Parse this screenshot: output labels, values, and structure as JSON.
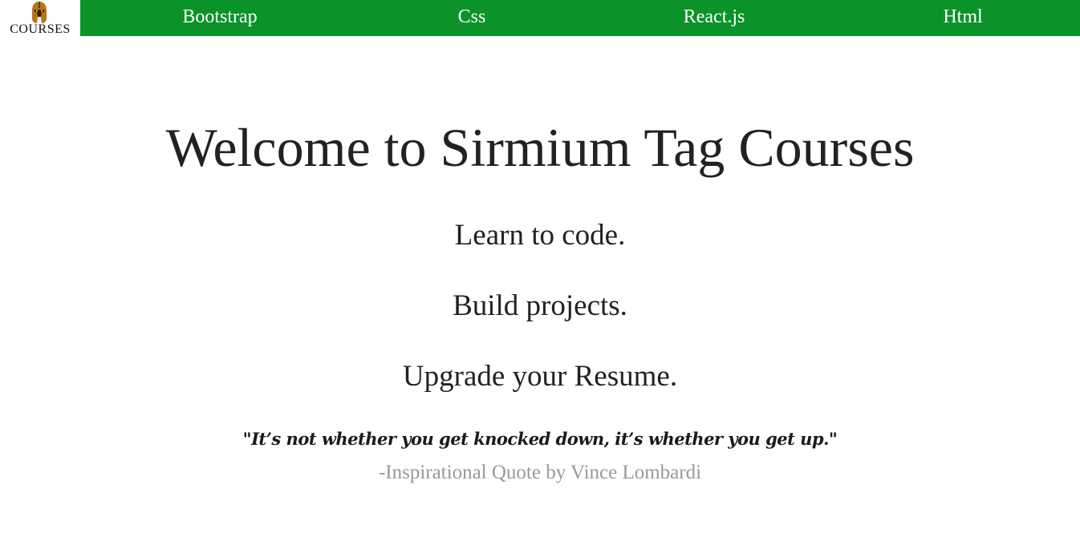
{
  "logo": {
    "text": "COURSES",
    "icon": "spartan-helmet-icon"
  },
  "nav": {
    "links": [
      {
        "label": "Bootstrap"
      },
      {
        "label": "Css"
      },
      {
        "label": "React.js"
      },
      {
        "label": "Html"
      }
    ],
    "background_color": "#0b932a",
    "text_color": "#ffffff"
  },
  "hero": {
    "title": "Welcome to Sirmium Tag Courses",
    "taglines": [
      "Learn to code.",
      "Build projects.",
      "Upgrade your Resume."
    ],
    "quote": "\"It’s not whether you get knocked down, it’s whether you get up.\"",
    "attribution": "-Inspirational Quote by Vince Lombardi"
  }
}
